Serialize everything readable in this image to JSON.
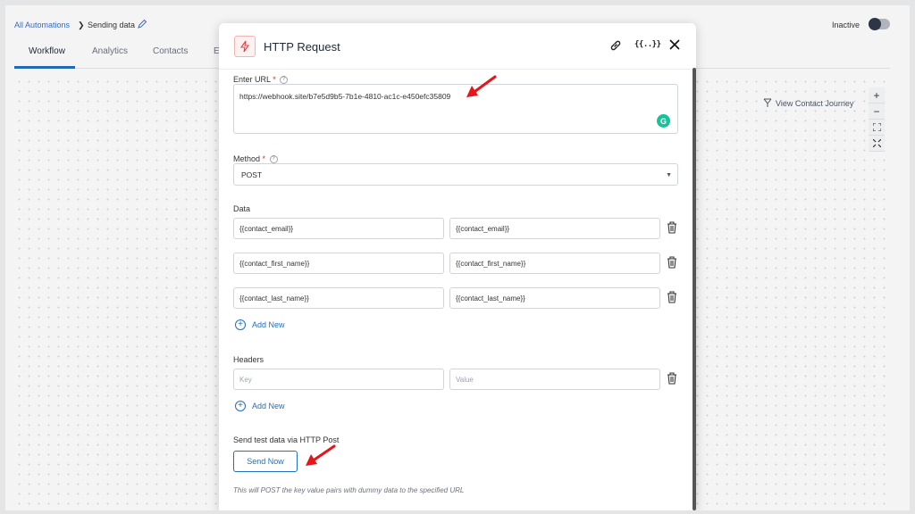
{
  "breadcrumb": {
    "root": "All Automations",
    "current": "Sending data"
  },
  "status": {
    "label": "Inactive",
    "active": false
  },
  "tabs": [
    {
      "label": "Workflow",
      "active": true
    },
    {
      "label": "Analytics",
      "active": false
    },
    {
      "label": "Contacts",
      "active": false
    },
    {
      "label": "E",
      "active": false
    }
  ],
  "canvas": {
    "view_contact_journey": "View Contact Journey",
    "zoom_in": "+",
    "zoom_out": "−"
  },
  "modal": {
    "title": "HTTP Request",
    "merge_tags_label": "{{..}}",
    "url": {
      "label": "Enter URL",
      "required_mark": "*",
      "value": "https://webhook.site/b7e5d9b5-7b1e-4810-ac1c-e450efc35809",
      "grammarly_label": "G"
    },
    "method": {
      "label": "Method",
      "required_mark": "*",
      "value": "POST"
    },
    "data": {
      "label": "Data",
      "rows": [
        {
          "key": "{{contact_email}}",
          "value": "{{contact_email}}"
        },
        {
          "key": "{{contact_first_name}}",
          "value": "{{contact_first_name}}"
        },
        {
          "key": "{{contact_last_name}}",
          "value": "{{contact_last_name}}"
        }
      ],
      "add_new": "Add New"
    },
    "headers": {
      "label": "Headers",
      "key_placeholder": "Key",
      "value_placeholder": "Value",
      "add_new": "Add New"
    },
    "test": {
      "label": "Send test data via HTTP Post",
      "button": "Send Now",
      "note": "This will POST the key value pairs with dummy data to the specified URL"
    }
  },
  "colors": {
    "accent": "#1f6fbf",
    "arrow": "#e8141b",
    "bolt": "#e2433b"
  }
}
